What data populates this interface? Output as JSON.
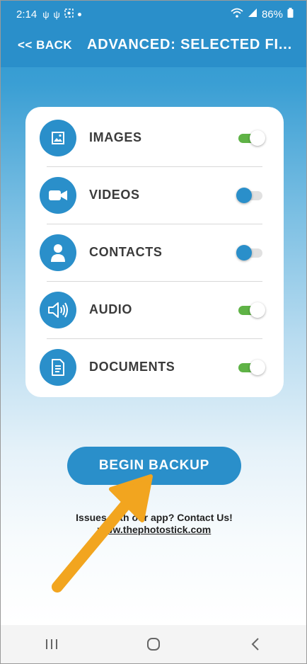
{
  "status_bar": {
    "time": "2:14",
    "battery": "86%",
    "icons": [
      "usb-icon",
      "usb-icon",
      "screenshot-icon",
      "notification-dot-icon",
      "wifi-icon",
      "signal-icon",
      "battery-icon"
    ]
  },
  "header": {
    "back_label": "<< BACK",
    "title": "ADVANCED: SELECTED FI..."
  },
  "file_types": [
    {
      "label": "IMAGES",
      "icon": "image-icon",
      "enabled": true
    },
    {
      "label": "VIDEOS",
      "icon": "video-camera-icon",
      "enabled": false
    },
    {
      "label": "CONTACTS",
      "icon": "person-icon",
      "enabled": false
    },
    {
      "label": "AUDIO",
      "icon": "speaker-icon",
      "enabled": true
    },
    {
      "label": "DOCUMENTS",
      "icon": "document-icon",
      "enabled": true
    }
  ],
  "begin_button": "BEGIN BACKUP",
  "footer": {
    "issues_text": "Issues with our app? Contact Us!",
    "site_link": "www.thephotostick.com"
  },
  "colors": {
    "brand_blue": "#2a8fca",
    "toggle_on": "#5fb346",
    "arrow": "#f2a51f"
  }
}
